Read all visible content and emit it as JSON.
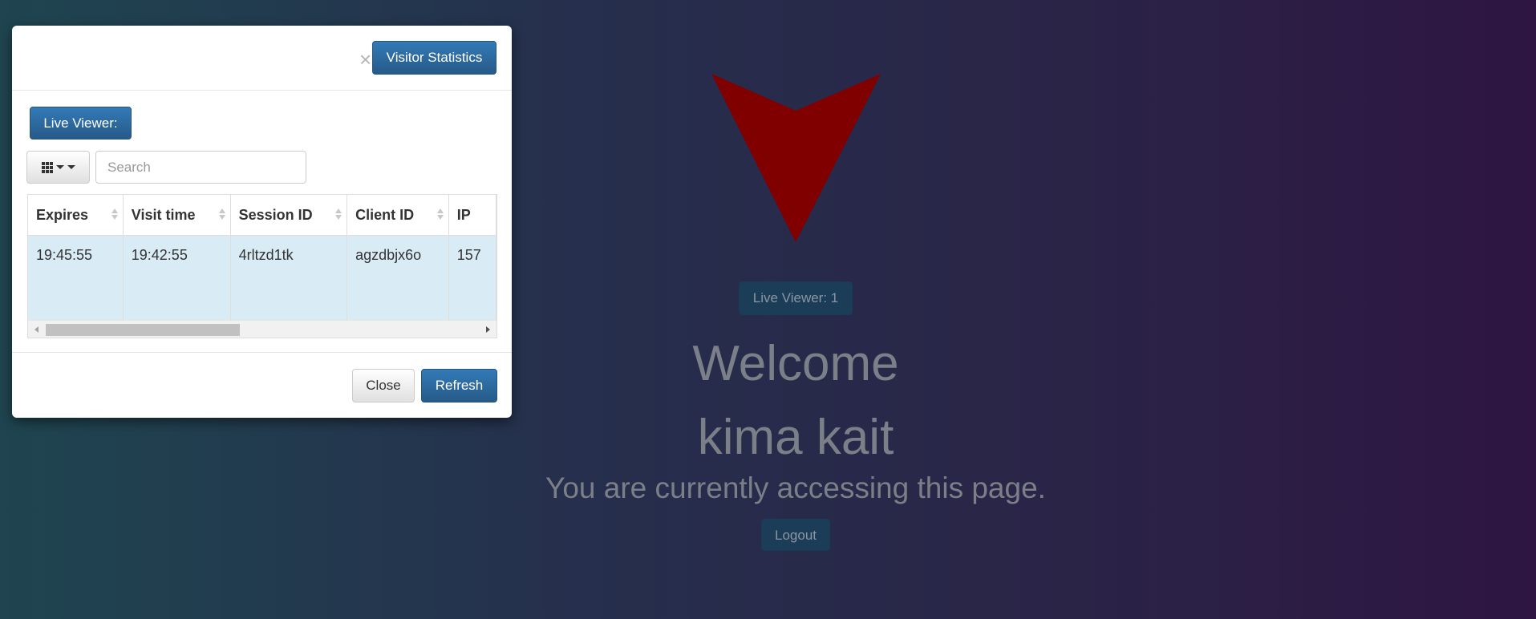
{
  "background": {
    "live_viewer_label": "Live Viewer: 1",
    "welcome": "Welcome",
    "user_name": "kima kait",
    "message": "You are currently accessing this page.",
    "logout_label": "Logout",
    "logo_color": "#800000"
  },
  "modal": {
    "close_symbol": "×",
    "visitor_statistics_label": "Visitor Statistics",
    "live_viewer_label": "Live Viewer:",
    "columns_icon": "grid-icon",
    "search_placeholder": "Search",
    "table": {
      "headers": [
        "Expires",
        "Visit time",
        "Session ID",
        "Client ID",
        "IP"
      ],
      "rows": [
        [
          "19:45:55",
          "19:42:55",
          "4rltzd1tk",
          "agzdbjx6o",
          "157"
        ]
      ]
    },
    "footer": {
      "close_label": "Close",
      "refresh_label": "Refresh"
    }
  },
  "colors": {
    "primary_button": "#337ab7",
    "selected_row": "#d9ebf5"
  }
}
